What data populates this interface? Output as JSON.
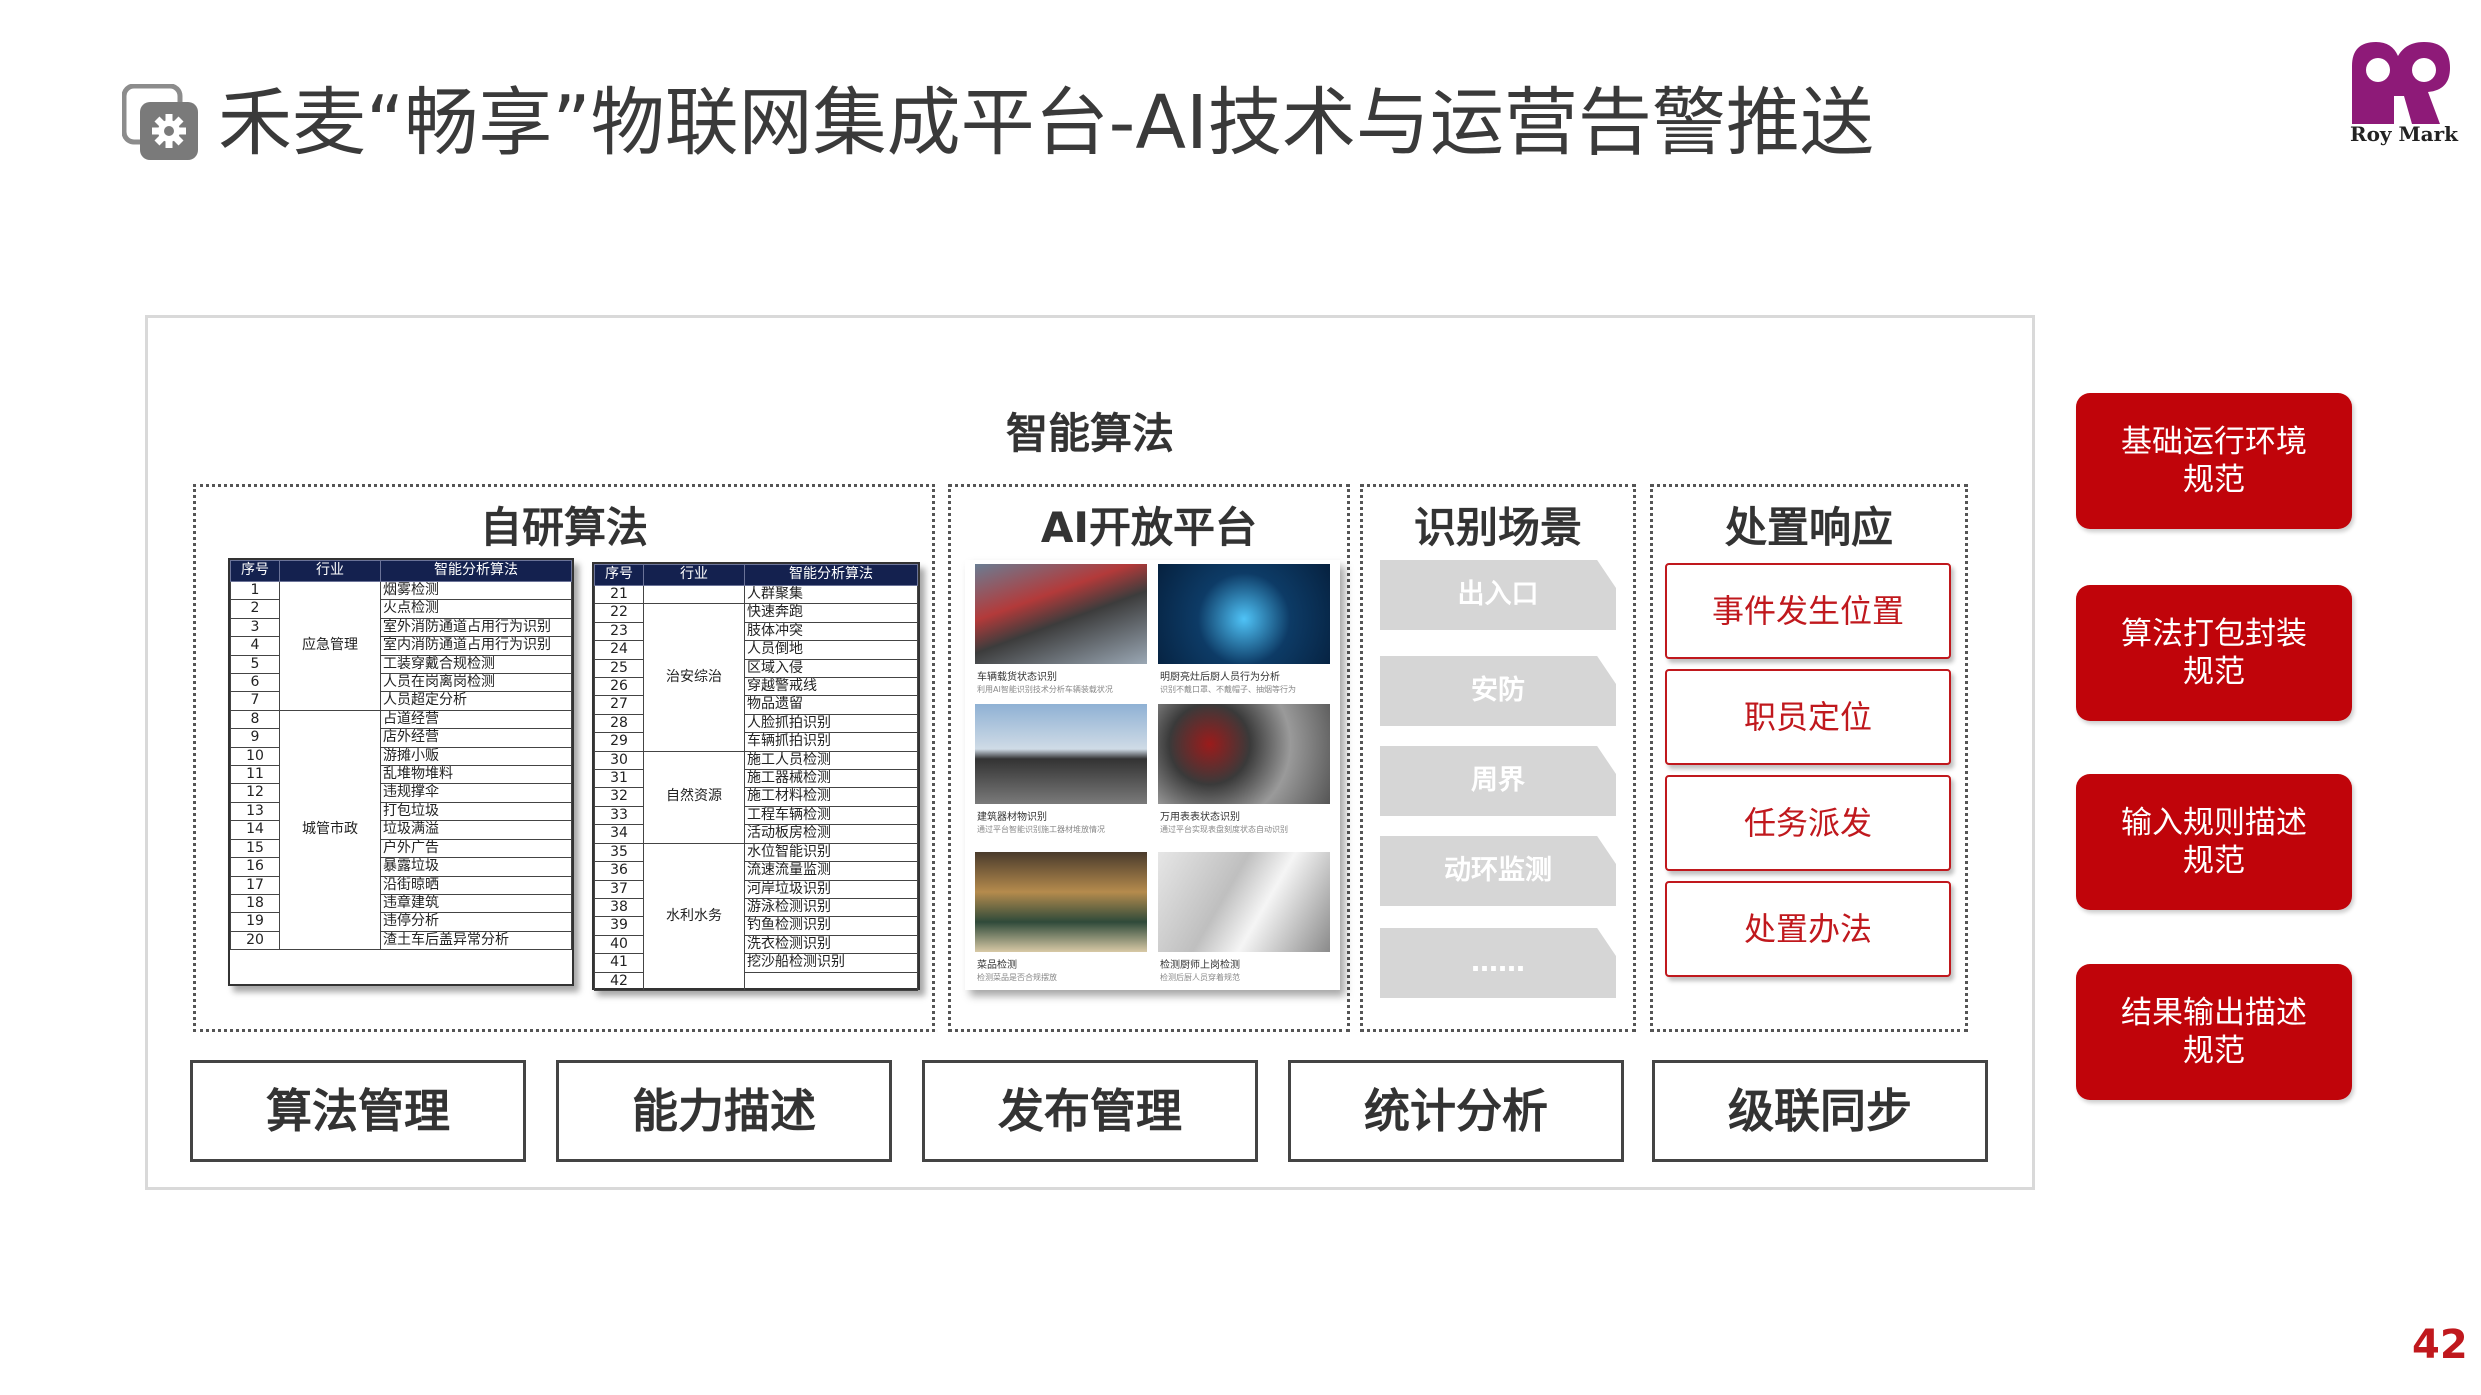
{
  "header": {
    "title": "禾麦“畅享”物联网集成平台-AI技术与运营告警推送",
    "logo_text": "Roy Mark",
    "page_number": "42"
  },
  "colors": {
    "accent_red": "#c0040a",
    "table_header": "#14214f",
    "scene_gray": "#d6d6d6"
  },
  "main": {
    "section_title": "智能算法",
    "panels": {
      "self": "自研算法",
      "ai": "AI开放平台",
      "scene": "识别场景",
      "response": "处置响应"
    },
    "table_headers": [
      "序号",
      "行业",
      "智能分析算法"
    ],
    "table_left": {
      "groups": [
        {
          "category": "应急管理",
          "rows": [
            [
              "1",
              "烟雾检测"
            ],
            [
              "2",
              "火点检测"
            ],
            [
              "3",
              "室外消防通道占用行为识别"
            ],
            [
              "4",
              "室内消防通道占用行为识别"
            ],
            [
              "5",
              "工装穿戴合规检测"
            ],
            [
              "6",
              "人员在岗离岗检测"
            ],
            [
              "7",
              "人员超定分析"
            ]
          ]
        },
        {
          "category": "城管市政",
          "rows": [
            [
              "8",
              "占道经营"
            ],
            [
              "9",
              "店外经营"
            ],
            [
              "10",
              "游摊小贩"
            ],
            [
              "11",
              "乱堆物堆料"
            ],
            [
              "12",
              "违规撑伞"
            ],
            [
              "13",
              "打包垃圾"
            ],
            [
              "14",
              "垃圾满溢"
            ],
            [
              "15",
              "户外广告"
            ],
            [
              "16",
              "暴露垃圾"
            ],
            [
              "17",
              "沿街晾晒"
            ],
            [
              "18",
              "违章建筑"
            ],
            [
              "19",
              "违停分析"
            ],
            [
              "20",
              "渣土车后盖异常分析"
            ]
          ]
        }
      ]
    },
    "table_right": {
      "groups": [
        {
          "category": "",
          "rows": [
            [
              "21",
              "人群聚集"
            ]
          ]
        },
        {
          "category": "治安综治",
          "rows": [
            [
              "22",
              "快速奔跑"
            ],
            [
              "23",
              "肢体冲突"
            ],
            [
              "24",
              "人员倒地"
            ],
            [
              "25",
              "区域入侵"
            ],
            [
              "26",
              "穿越警戒线"
            ],
            [
              "27",
              "物品遗留"
            ],
            [
              "28",
              "人脸抓拍识别"
            ],
            [
              "29",
              "车辆抓拍识别"
            ]
          ]
        },
        {
          "category": "自然资源",
          "rows": [
            [
              "30",
              "施工人员检测"
            ],
            [
              "31",
              "施工器械检测"
            ],
            [
              "32",
              "施工材料检测"
            ],
            [
              "33",
              "工程车辆检测"
            ],
            [
              "34",
              "活动板房检测"
            ]
          ]
        },
        {
          "category": "水利水务",
          "rows": [
            [
              "35",
              "水位智能识别"
            ],
            [
              "36",
              "流速流量监测"
            ],
            [
              "37",
              "河岸垃圾识别"
            ],
            [
              "38",
              "游泳检测识别"
            ],
            [
              "39",
              "钓鱼检测识别"
            ],
            [
              "40",
              "洗衣检测识别"
            ],
            [
              "41",
              "挖沙船检测识别"
            ],
            [
              "42",
              ""
            ]
          ]
        }
      ]
    },
    "ai_cards": [
      {
        "caption": "车辆载货状态识别",
        "sub": "利用AI智能识别技术分析车辆装载状况"
      },
      {
        "caption": "明厨亮灶后厨人员行为分析",
        "sub": "识别不戴口罩、不戴帽子、抽烟等行为"
      },
      {
        "caption": "建筑器材物识别",
        "sub": "通过平台智能识别施工器材堆放情况"
      },
      {
        "caption": "万用表表状态识别",
        "sub": "通过平台实现表盘刻度状态自动识别"
      },
      {
        "caption": "菜品检测",
        "sub": "检测菜品是否合规摆放"
      },
      {
        "caption": "检测厨师上岗检测",
        "sub": "检测后厨人员穿着规范"
      }
    ],
    "scenes": [
      "出入口",
      "安防",
      "周界",
      "动环监测",
      "……"
    ],
    "responses": [
      "事件发生位置",
      "职员定位",
      "任务派发",
      "处置办法"
    ],
    "bottom_buttons": [
      "算法管理",
      "能力描述",
      "发布管理",
      "统计分析",
      "级联同步"
    ]
  },
  "right_buttons": [
    "基础运行环境\n规范",
    "算法打包封装\n规范",
    "输入规则描述\n规范",
    "结果输出描述\n规范"
  ],
  "icons": {
    "title_icon": "gear-icon",
    "logo": "roy-mark-logo"
  }
}
